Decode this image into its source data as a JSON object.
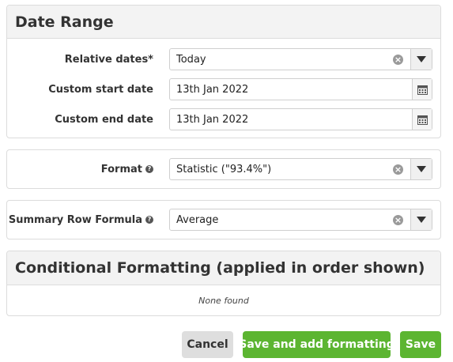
{
  "date_range": {
    "title": "Date Range",
    "relative_dates": {
      "label": "Relative dates*",
      "value": "Today"
    },
    "custom_start": {
      "label": "Custom start date",
      "value": "13th Jan 2022"
    },
    "custom_end": {
      "label": "Custom end date",
      "value": "13th Jan 2022"
    }
  },
  "format": {
    "label": "Format",
    "value": "Statistic (\"93.4%\")"
  },
  "summary": {
    "label": "Summary Row Formula",
    "value": "Average"
  },
  "conditional": {
    "title": "Conditional Formatting (applied in order shown)",
    "empty_text": "None found"
  },
  "buttons": {
    "cancel": "Cancel",
    "save_add": "Save and add formatting",
    "save": "Save"
  },
  "colors": {
    "primary_green": "#5cb531",
    "cancel_gray": "#dedede",
    "header_bg": "#f3f3f3"
  }
}
